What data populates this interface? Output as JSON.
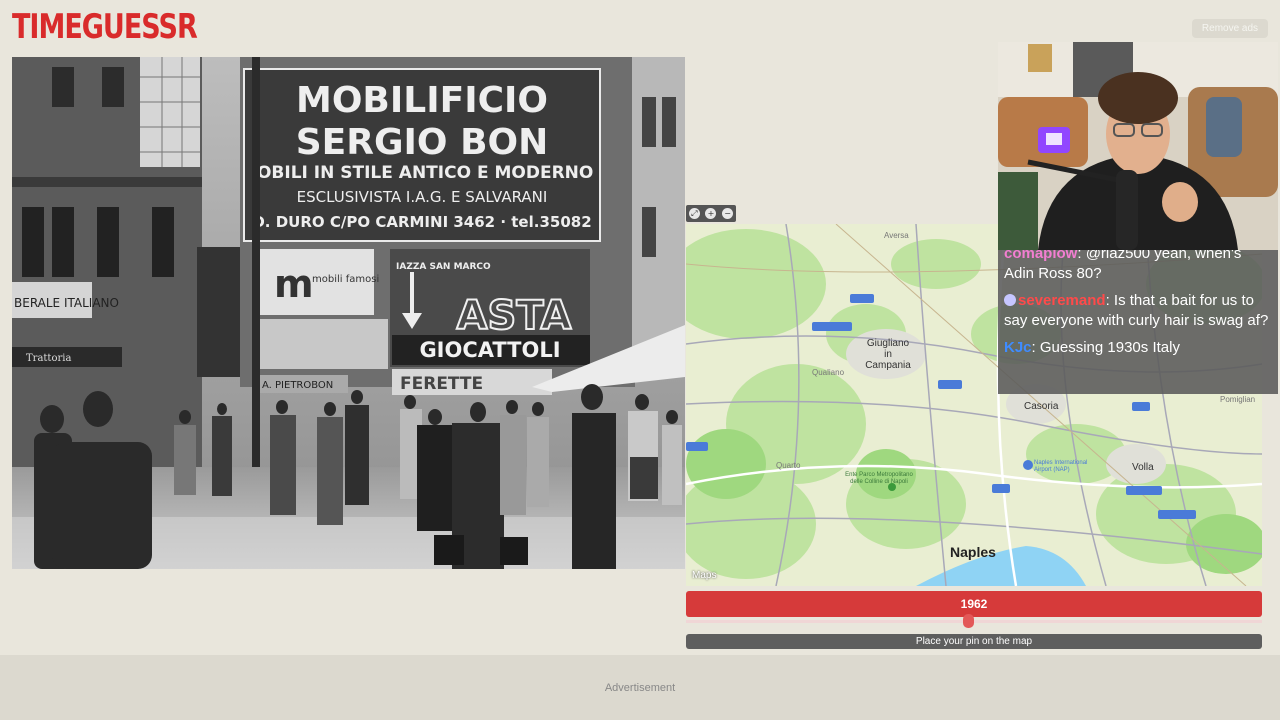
{
  "header": {
    "logo": "TIMEGUESSR",
    "remove_ads": "Remove ads"
  },
  "photo": {
    "signs": {
      "mobilificio_l1": "MOBILIFICIO",
      "mobilificio_l2": "SERGIO BON",
      "mobilificio_l3": "IOBILI IN STILE ANTICO E MODERNO",
      "mobilificio_l4": "ESCLUSIVISTA  I.A.G.  E  SALVARANI",
      "mobilificio_l5": "D. DURO C/PO CARMINI 3462 · tel.35082",
      "asta": "ASTA",
      "giocattoli": "GIOCATTOLI",
      "piazza": "IAZZA SAN MARCO",
      "mobili_famosi": "mobili famosi",
      "ferrette": "FERETTE",
      "pietrobon": "A. PIETROBON",
      "italiane": "BERALE ITALIANO",
      "trattoria": "Trattoria"
    }
  },
  "map": {
    "labels": {
      "aversa": "Aversa",
      "giugliano": "Giugliano\nin\nCampania",
      "qualiano": "Qualiano",
      "casoria": "Casoria",
      "quarto": "Quarto",
      "volla": "Volla",
      "naples": "Naples",
      "pomigliano": "Pomiglian",
      "airport": "Naples International Airport (NAP)",
      "park": "Ente Parco Metropolitano delle Colline di Napoli"
    },
    "attribution": "Maps"
  },
  "game": {
    "year": "1962",
    "year_fraction": 0.49,
    "place_pin": "Place your pin on the map"
  },
  "ad": {
    "label": "Advertisement"
  },
  "chat": {
    "messages": [
      {
        "user": "comaplow",
        "text": ": @riaz500 yeah, when's Adin Ross 80?",
        "color": "#f27ed1"
      },
      {
        "user": "severemand",
        "text": ": Is that a bait for us to say everyone with curly hair is swag af?",
        "color": "#ff4a4a"
      },
      {
        "user": "KJc",
        "text": ": Guessing 1930s Italy",
        "color": "#3f8cff"
      }
    ]
  },
  "colors": {
    "accent": "#d92b2b",
    "year_bar": "#d63a3a",
    "background": "#e9e6dc"
  }
}
